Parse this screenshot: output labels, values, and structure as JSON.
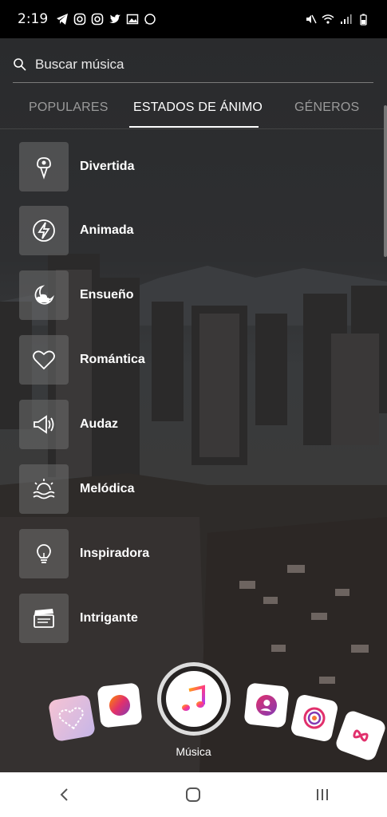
{
  "status_bar": {
    "time": "2:19"
  },
  "search": {
    "placeholder": "Buscar música"
  },
  "tabs": [
    {
      "label": "POPULARES",
      "active": false
    },
    {
      "label": "ESTADOS DE ÁNIMO",
      "active": true
    },
    {
      "label": "GÉNEROS",
      "active": false
    }
  ],
  "moods": [
    {
      "label": "Divertida",
      "icon": "ice-cream-icon"
    },
    {
      "label": "Animada",
      "icon": "lightning-icon"
    },
    {
      "label": "Ensueño",
      "icon": "moon-cloud-icon"
    },
    {
      "label": "Romántica",
      "icon": "heart-icon"
    },
    {
      "label": "Audaz",
      "icon": "megaphone-icon"
    },
    {
      "label": "Melódica",
      "icon": "sunset-waves-icon"
    },
    {
      "label": "Inspiradora",
      "icon": "lightbulb-icon"
    },
    {
      "label": "Intrigante",
      "icon": "clapperboard-icon"
    }
  ],
  "capture": {
    "label": "Música"
  },
  "colors": {
    "accent_gradient_start": "#ff8a00",
    "accent_gradient_end": "#e1306c",
    "tab_inactive": "#9a9a9a"
  }
}
